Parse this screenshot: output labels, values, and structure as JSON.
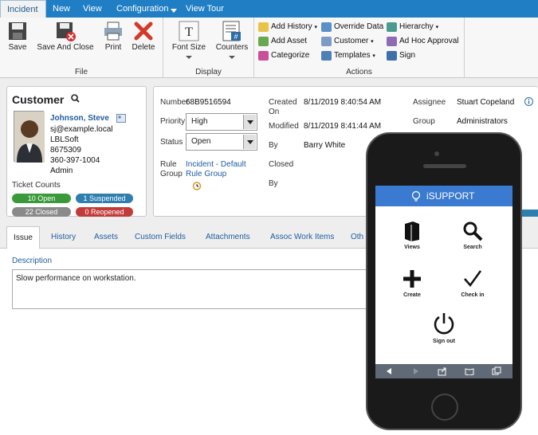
{
  "menubar": {
    "tabs": [
      "Incident",
      "New",
      "View",
      "Configuration",
      "View Tour"
    ]
  },
  "ribbon": {
    "file": {
      "label": "File",
      "buttons": [
        "Save",
        "Save And Close",
        "Print",
        "Delete"
      ]
    },
    "display": {
      "label": "Display",
      "buttons": [
        "Font Size",
        "Counters"
      ]
    },
    "actions": {
      "label": "Actions",
      "items": [
        "Add History",
        "Override Data",
        "Hierarchy",
        "Add Asset",
        "Customer",
        "Ad Hoc Approval",
        "Categorize",
        "Templates",
        "Sign"
      ]
    }
  },
  "customer": {
    "heading": "Customer",
    "name": "Johnson, Steve",
    "email": "sj@example.local",
    "company": "LBLSoft",
    "phone1": "8675309",
    "phone2": "360-397-1004",
    "role": "Admin",
    "ticket_counts_label": "Ticket Counts",
    "counts": {
      "open": "10 Open",
      "suspended": "1 Suspended",
      "closed": "22 Closed",
      "reopened": "0 Reopened"
    }
  },
  "ticket": {
    "number_label": "Number",
    "number": "68B9516594",
    "priority_label": "Priority",
    "priority": "High",
    "status_label": "Status",
    "status": "Open",
    "rule_group_label_1": "Rule",
    "rule_group_label_2": "Group",
    "rule_group_1": "Incident - Default",
    "rule_group_2": "Rule Group",
    "created_label_1": "Created",
    "created_label_2": "On",
    "created": "8/11/2019 8:40:54 AM",
    "modified_label": "Modified",
    "modified": "8/11/2019 8:41:44 AM",
    "by_label": "By",
    "by": "Barry White",
    "closed_label": "Closed",
    "by2_label": "By",
    "assignee_label": "Assignee",
    "assignee": "Stuart Copeland",
    "group_label": "Group",
    "group": "Administrators"
  },
  "tabs": [
    "Issue",
    "History",
    "Assets",
    "Custom Fields",
    "Attachments",
    "Assoc Work Items",
    "Oth"
  ],
  "description": {
    "label": "Description",
    "text": "Slow performance on workstation."
  },
  "phone": {
    "brand": "iSUPPORT",
    "items": [
      "Views",
      "Search",
      "Create",
      "Check in",
      "Sign out"
    ]
  },
  "colors": {
    "accent": "#1f7ec4",
    "open": "#3a9a3a",
    "suspended": "#2e7fb0",
    "closed": "#8a8a8a",
    "reopened": "#c23b3b"
  }
}
